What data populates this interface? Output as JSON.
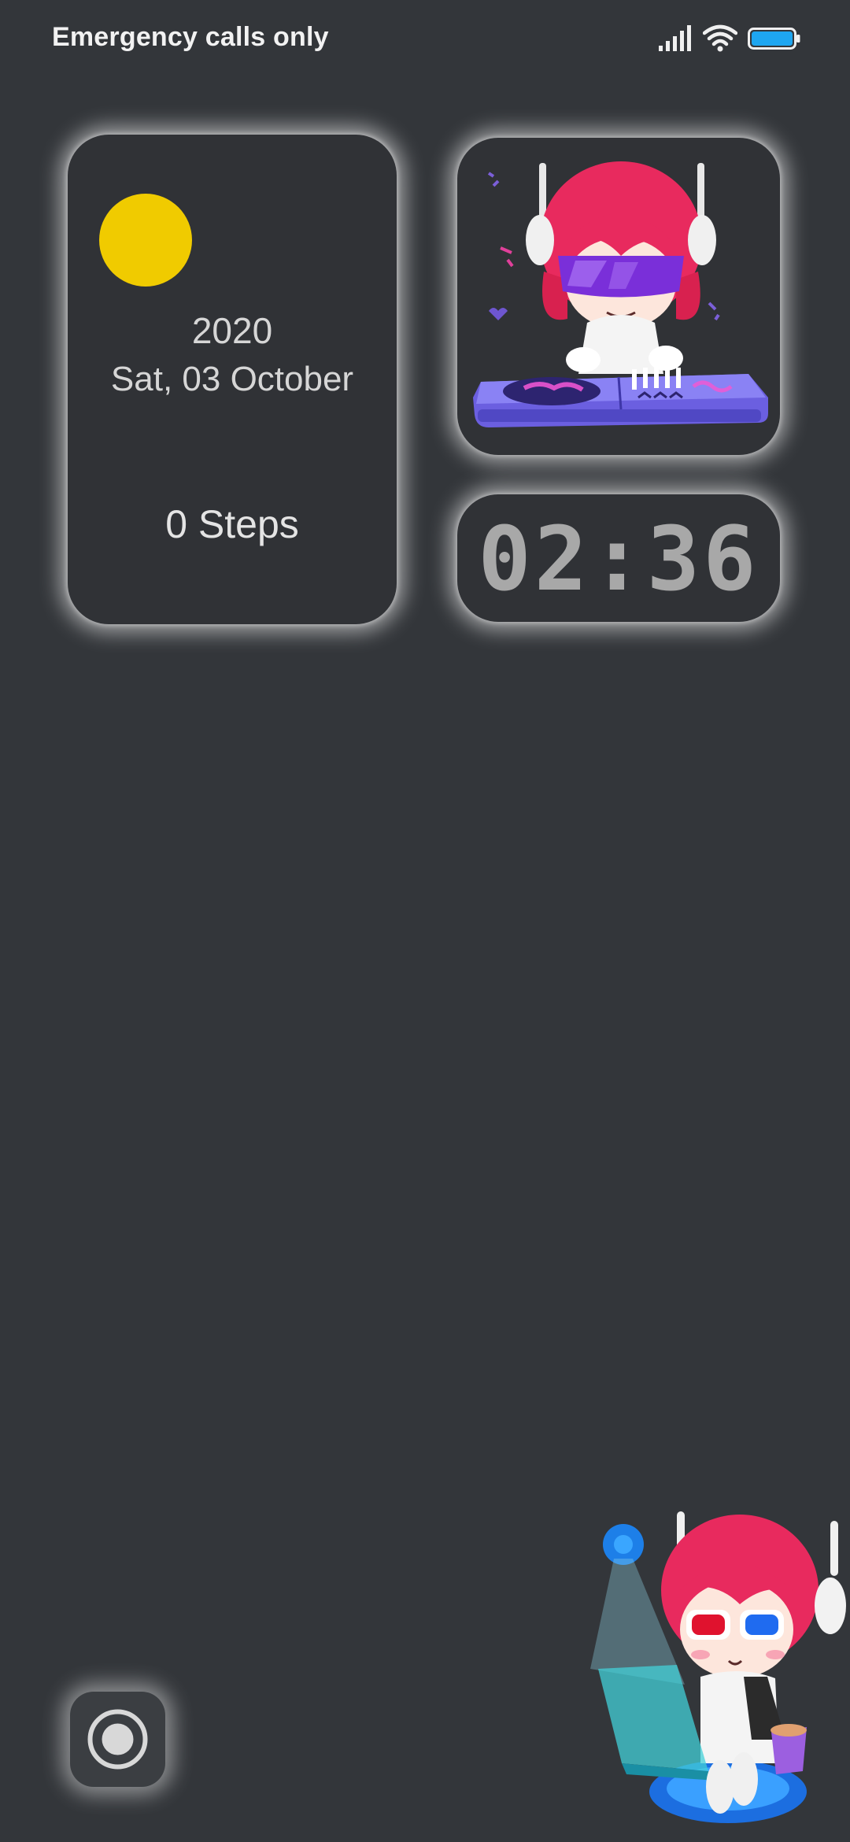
{
  "status_bar": {
    "carrier_text": "Emergency calls only",
    "icons": [
      "signal-icon",
      "wifi-icon",
      "battery-icon"
    ],
    "battery_color": "#1ea6f0"
  },
  "widgets": {
    "weather": {
      "icon": "sun-icon",
      "sun_color": "#f0cb00",
      "year": "2020",
      "date": "Sat, 03 October",
      "steps": "0 Steps"
    },
    "clock": {
      "time": "02:36"
    },
    "dj_sticker": {
      "image": "dj-character-illustration"
    }
  },
  "lockscreen": {
    "camera_icon": "camera-shutter-icon",
    "decoration": "mascot-3d-glasses-illustration"
  },
  "colors": {
    "background": "#33363a",
    "card": "#303236",
    "card_glow": "#ffffff",
    "text": "#d6d6d6"
  }
}
